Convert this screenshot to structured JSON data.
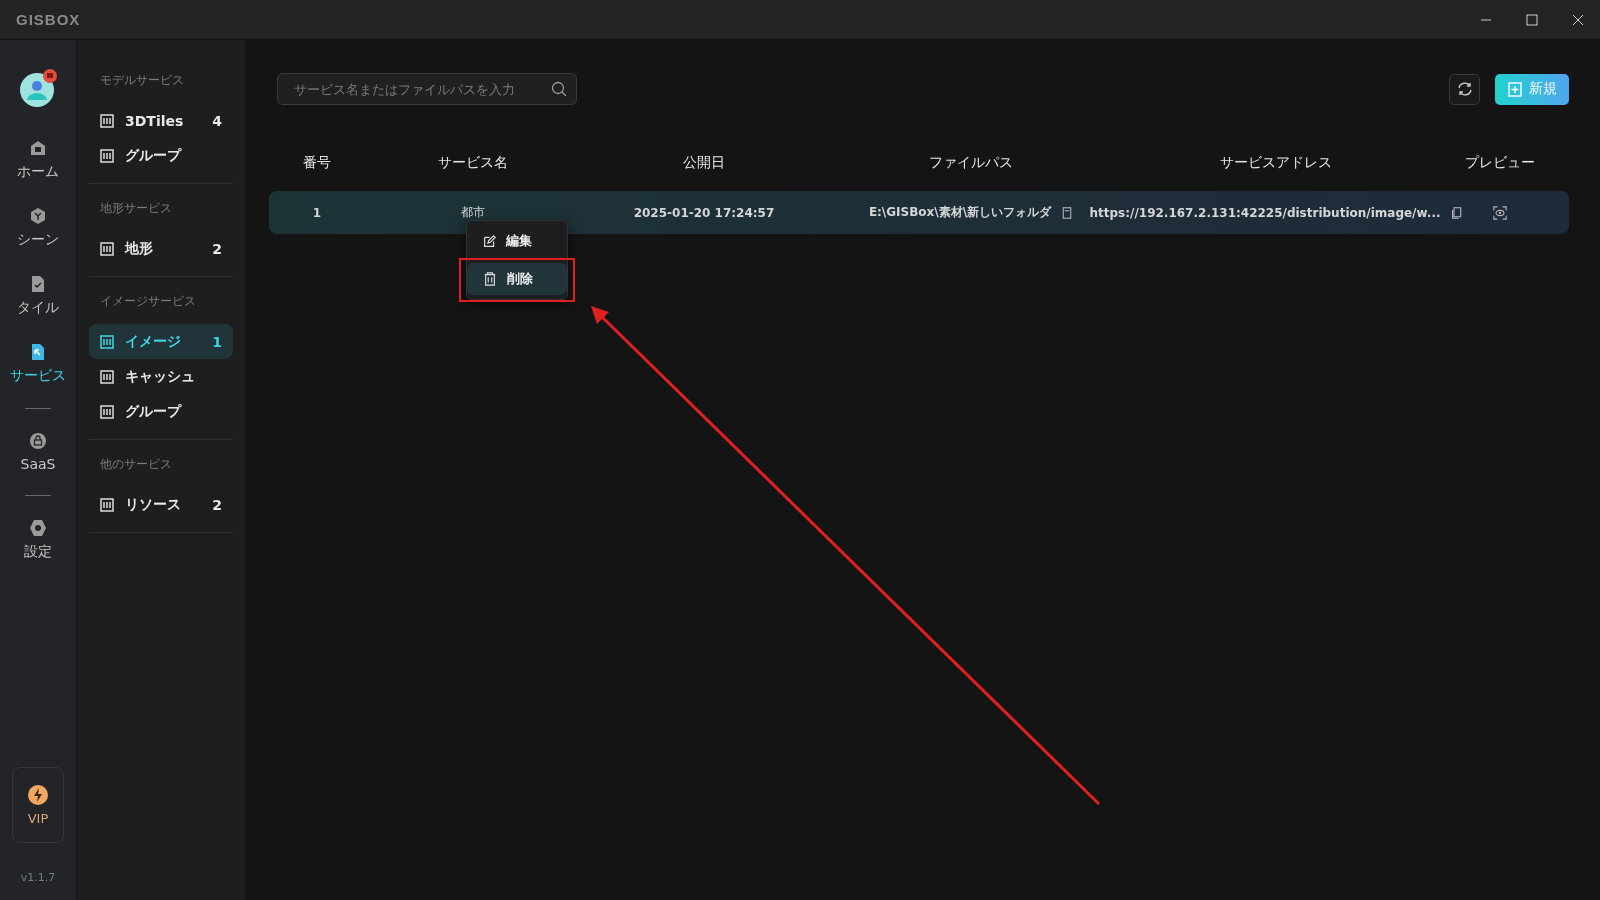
{
  "window": {
    "title": "GISBOX"
  },
  "nav": {
    "items": [
      {
        "label": "ホーム",
        "selected": false
      },
      {
        "label": "シーン",
        "selected": false
      },
      {
        "label": "タイル",
        "selected": false
      },
      {
        "label": "サービス",
        "selected": true
      },
      {
        "label": "SaaS",
        "selected": false,
        "divider_before": true
      },
      {
        "label": "設定",
        "selected": false,
        "divider_before": true
      }
    ],
    "vip": "VIP",
    "version": "v1.1.7"
  },
  "sidebar": {
    "groups": [
      {
        "title": "モデルサービス",
        "items": [
          {
            "label": "3DTiles",
            "count": "4",
            "selected": false
          },
          {
            "label": "グループ",
            "selected": false
          }
        ]
      },
      {
        "title": "地形サービス",
        "items": [
          {
            "label": "地形",
            "count": "2",
            "selected": false
          }
        ]
      },
      {
        "title": "イメージサービス",
        "items": [
          {
            "label": "イメージ",
            "count": "1",
            "selected": true
          },
          {
            "label": "キャッシュ",
            "selected": false
          },
          {
            "label": "グループ",
            "selected": false
          }
        ]
      },
      {
        "title": "他のサービス",
        "items": [
          {
            "label": "リソース",
            "count": "2",
            "selected": false
          }
        ]
      }
    ]
  },
  "search": {
    "placeholder": "サービス名またはファイルパスを入力"
  },
  "new_button": "新規",
  "table": {
    "columns": [
      "番号",
      "サービス名",
      "公開日",
      "ファイルパス",
      "サービスアドレス",
      "プレビュー"
    ],
    "rows": [
      {
        "number": "1",
        "name": "都市",
        "date": "2025-01-20 17:24:57",
        "path": "E:\\GISBox\\素材\\新しいフォルダ",
        "address": "https://192.167.2.131:42225/distribution/image/w...",
        "selected": true
      }
    ]
  },
  "context_menu": {
    "items": [
      {
        "label": "編集",
        "selected": false
      },
      {
        "label": "削除",
        "selected": true,
        "highlighted": true
      }
    ]
  }
}
